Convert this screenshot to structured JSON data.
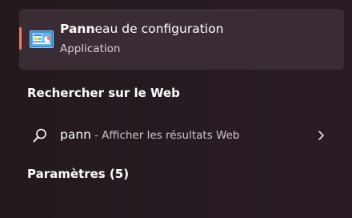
{
  "best_match": {
    "title_bold": "Pann",
    "title_rest": "eau de configuration",
    "subtitle": "Application",
    "icon": "control-panel-icon"
  },
  "web_section": {
    "heading": "Rechercher sur le Web",
    "query": "pann",
    "suffix": "- Afficher les résultats Web",
    "icon": "search-icon"
  },
  "settings_section": {
    "heading": "Paramètres (5)"
  },
  "colors": {
    "accent": "#f17c5a",
    "selected_bg": "#3a2c34",
    "background": "#271b23"
  }
}
